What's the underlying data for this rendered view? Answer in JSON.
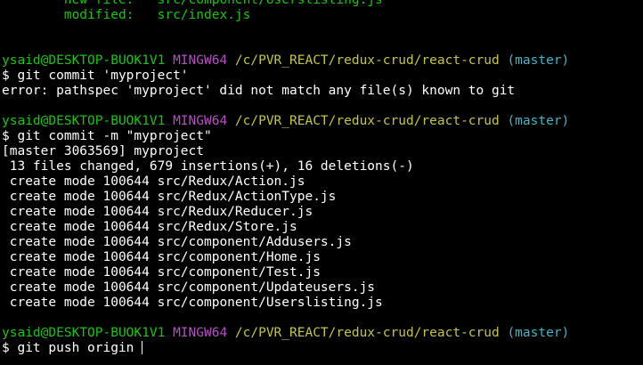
{
  "status_entries": [
    {
      "label": "new file:   ",
      "path": "src/component/Userslisting.js"
    },
    {
      "label": "modified:   ",
      "path": "src/index.js"
    }
  ],
  "prompt": {
    "user_host": "ysaid@DESKTOP-BUOK1V1",
    "env": "MINGW64",
    "path": "/c/PVR_REACT/redux-crud/react-crud",
    "branch": "(master)",
    "symbol": "$"
  },
  "commands": {
    "first": "git commit 'myproject'",
    "second": "git commit -m \"myproject\"",
    "third": "git push origin "
  },
  "outputs": {
    "error": "error: pathspec 'myproject' did not match any file(s) known to git",
    "commit_header": "[master 3063569] myproject",
    "commit_summary": " 13 files changed, 679 insertions(+), 16 deletions(-)",
    "create_prefix": " create mode 100644 ",
    "created_files": [
      "src/Redux/Action.js",
      "src/Redux/ActionType.js",
      "src/Redux/Reducer.js",
      "src/Redux/Store.js",
      "src/component/Addusers.js",
      "src/component/Home.js",
      "src/component/Test.js",
      "src/component/Updateusers.js",
      "src/component/Userslisting.js"
    ]
  },
  "colors": {
    "background": "#000000",
    "text": "#ffffff",
    "green": "#16c60c",
    "magenta": "#b64fc4",
    "yellow": "#c6c63c",
    "cyan": "#3fb7c8"
  }
}
